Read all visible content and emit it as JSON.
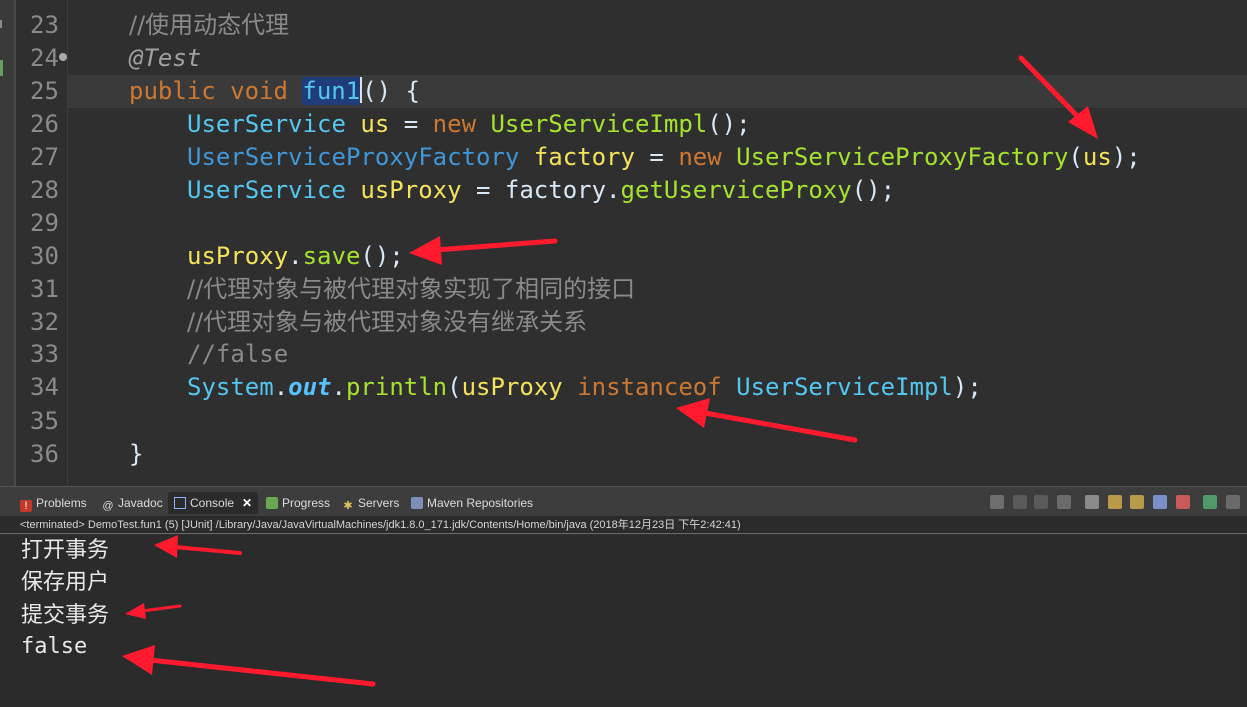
{
  "editor": {
    "lines": [
      {
        "num": "23"
      },
      {
        "num": "24"
      },
      {
        "num": "25"
      },
      {
        "num": "26"
      },
      {
        "num": "27"
      },
      {
        "num": "28"
      },
      {
        "num": "29"
      },
      {
        "num": "30"
      },
      {
        "num": "31"
      },
      {
        "num": "32"
      },
      {
        "num": "33"
      },
      {
        "num": "34"
      },
      {
        "num": "35"
      },
      {
        "num": "36"
      }
    ],
    "code": {
      "l23": "//使用动态代理",
      "l24": "@Test",
      "l25_kw1": "public",
      "l25_kw2": "void",
      "l25_method": "fun1",
      "l25_rest": "() {",
      "l26_type": "UserService",
      "l26_var": "us",
      "l26_eq": " = ",
      "l26_new": "new",
      "l26_ctor": "UserServiceImpl",
      "l26_end": "();",
      "l27_type": "UserServiceProxyFactory",
      "l27_var": "factory",
      "l27_eq": " = ",
      "l27_new": "new",
      "l27_ctor": "UserServiceProxyFactory",
      "l27_arg_open": "(",
      "l27_arg": "us",
      "l27_end": ");",
      "l28_type": "UserService",
      "l28_var": "usProxy",
      "l28_eq": " = factory.",
      "l28_call": "getUserviceProxy",
      "l28_end": "();",
      "l30_obj": "usProxy",
      "l30_dot": ".",
      "l30_call": "save",
      "l30_end": "();",
      "l31": "//代理对象与被代理对象实现了相同的接口",
      "l32": "//代理对象与被代理对象没有继承关系",
      "l33": "//false",
      "l34_sys": "System",
      "l34_dot1": ".",
      "l34_out": "out",
      "l34_dot2": ".",
      "l34_call": "println",
      "l34_open": "(",
      "l34_arg": "usProxy",
      "l34_kw": "instanceof",
      "l34_type": "UserServiceImpl",
      "l34_end": ");",
      "l36": "}"
    }
  },
  "views": {
    "tabs": [
      {
        "label": "Problems"
      },
      {
        "label": "Javadoc"
      },
      {
        "label": "Console"
      },
      {
        "label": "Progress"
      },
      {
        "label": "Servers"
      },
      {
        "label": "Maven Repositories"
      }
    ],
    "close_glyph": "✕"
  },
  "console": {
    "status": "<terminated> DemoTest.fun1 (5) [JUnit] /Library/Java/JavaVirtualMachines/jdk1.8.0_171.jdk/Contents/Home/bin/java (2018年12月23日 下午2:42:41)",
    "output": [
      "打开事务",
      "保存用户",
      "提交事务",
      "false"
    ]
  },
  "colors": {
    "arrow": "#ff1a2e",
    "keyword": "#cc7832",
    "type": "#53c7f0",
    "variable": "#f4e35a",
    "method": "#a6e22e"
  }
}
